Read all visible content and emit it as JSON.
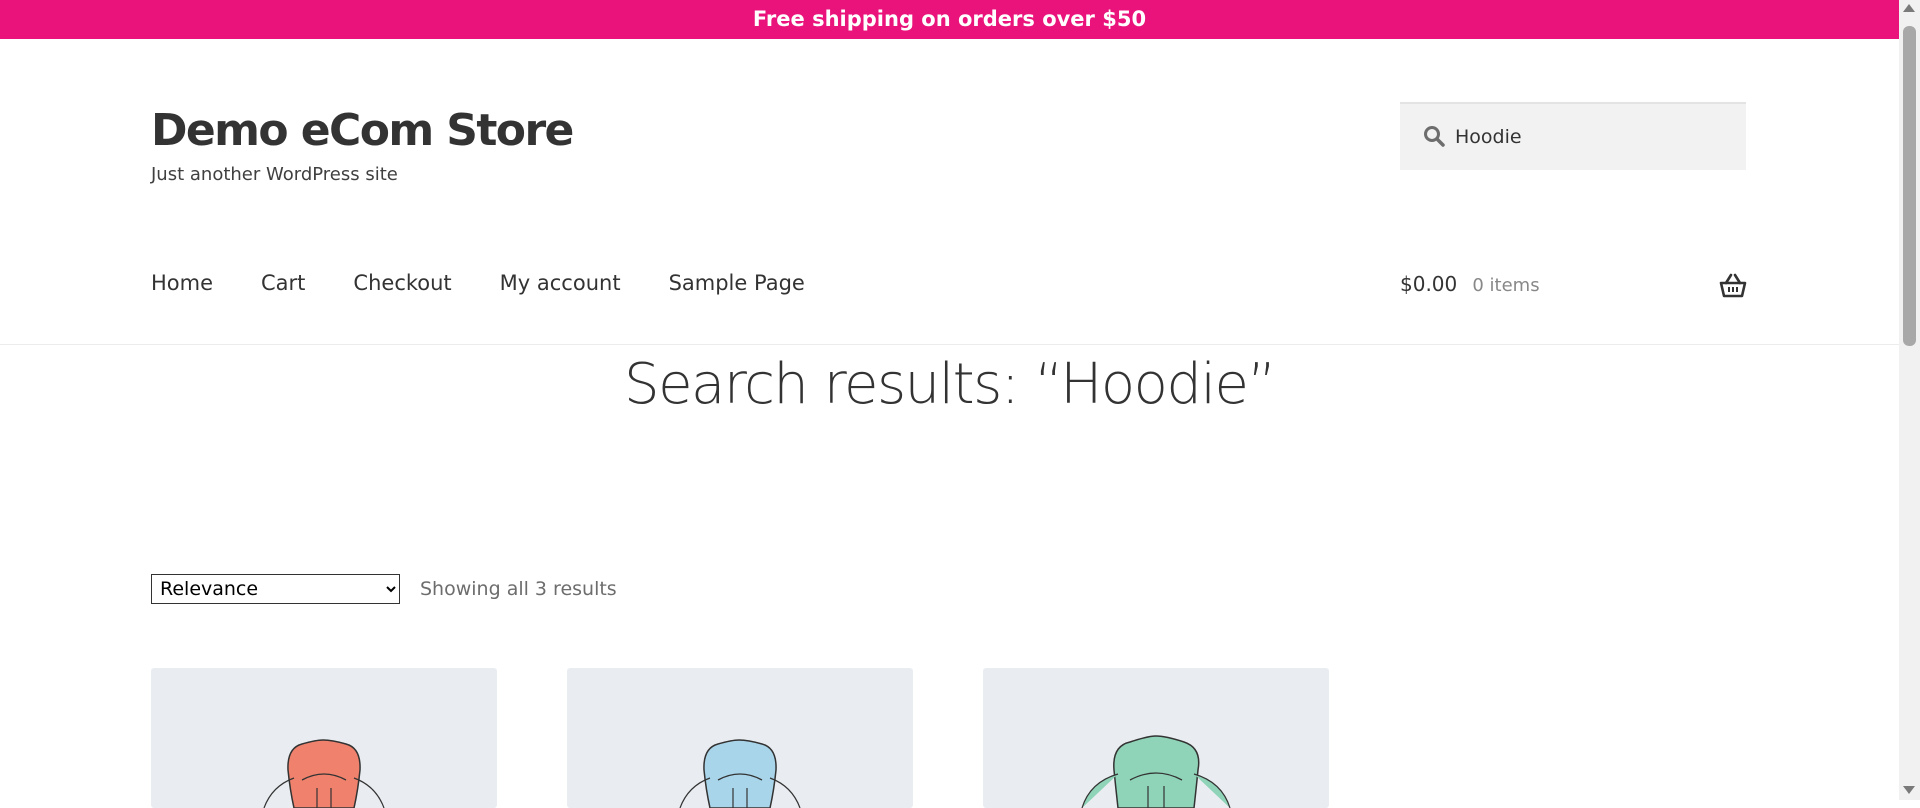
{
  "banner": {
    "text": "Free shipping on orders over $50",
    "bg_color": "#e9137b"
  },
  "site": {
    "title": "Demo eCom Store",
    "tagline": "Just another WordPress site"
  },
  "search": {
    "value": "Hoodie",
    "icon": "search-icon"
  },
  "nav": {
    "items": [
      "Home",
      "Cart",
      "Checkout",
      "My account",
      "Sample Page"
    ]
  },
  "cart": {
    "total": "$0.00",
    "count": "0 items",
    "icon": "basket-icon"
  },
  "page": {
    "title": "Search results: “Hoodie”"
  },
  "sort": {
    "selected": "Relevance",
    "options": [
      "Relevance"
    ]
  },
  "results": {
    "count_text": "Showing all 3 results"
  },
  "products": [
    {
      "image": "hoodie-red",
      "color": "#f0826d"
    },
    {
      "image": "hoodie-blue",
      "color": "#a9d5ea"
    },
    {
      "image": "hoodie-green",
      "color": "#8fd4b8"
    }
  ]
}
